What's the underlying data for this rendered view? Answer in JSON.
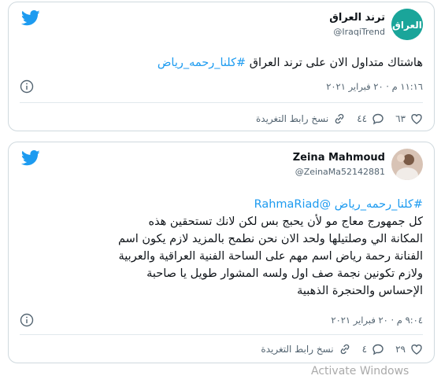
{
  "tweets": [
    {
      "author_name": "ترند العراق",
      "handle": "@IraqiTrend",
      "avatar_text": "العراق",
      "text_plain": "هاشتاك متداول الان على ترند العراق ",
      "hashtag": "#كلنا_رحمه_رياض",
      "time": "١١:١٦ م · ٢٠ فبراير ٢٠٢١",
      "likes": "٦٣",
      "replies": "٤٤",
      "copy_link": "نسخ رابط التغريدة"
    },
    {
      "author_name": "Zeina Mahmoud",
      "handle": "@ZeinaMa52142881",
      "hashtag": "#كلنا_رحمه_رياض",
      "mention": "@RahmaRiad",
      "body_lines": [
        "كل جمهورج معاج مو لأن يحبج بس لكن لانك تستحقين هذه",
        "المكانة الي وصلتيلها ولحد الان نحن نطمح بالمزيد لازم يكون اسم",
        "الفنانة رحمة رياض اسم مهم على الساحة الفنية العراقية والعربية",
        "ولازم تكونين نجمة صف اول ولسه المشوار طويل يا صاحبة",
        "الإحساس والحنجرة الذهبية"
      ],
      "time": "٩:٠٤ م · ٢٠ فبراير ٢٠٢١",
      "likes": "٢٩",
      "replies": "٤",
      "copy_link": "نسخ رابط التغريدة"
    }
  ],
  "watermark": "Activate Windows",
  "colors": {
    "accent": "#1d9bf0",
    "avatar_bg": "#1aa59a"
  },
  "icons": [
    "twitter-bird-icon",
    "heart-icon",
    "reply-icon",
    "link-icon",
    "info-icon"
  ]
}
